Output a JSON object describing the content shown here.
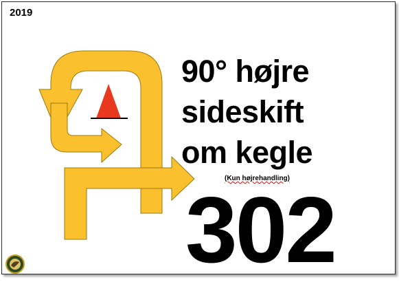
{
  "year": "2019",
  "title": {
    "line1": "90° højre",
    "line2": "sideskift",
    "line3": "om kegle"
  },
  "note": "(Kun højrehandling)",
  "number": "302",
  "colors": {
    "arrow_fill": "#fbc02d",
    "arrow_stroke": "#9a7a10",
    "cone": "#e8391e",
    "text": "#000000"
  }
}
